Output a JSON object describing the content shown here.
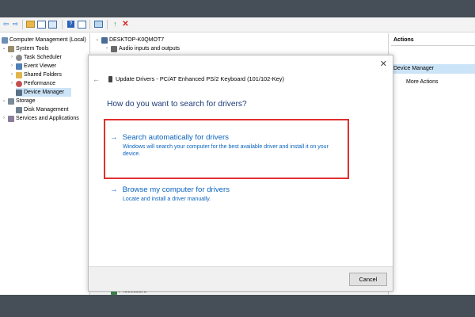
{
  "toolbar": {
    "icons": [
      "back-arrow-icon",
      "forward-arrow-icon",
      "up-folder-icon",
      "console-tree-icon",
      "properties-icon",
      "help-icon",
      "view-icon",
      "monitor-icon",
      "update-driver-icon",
      "delete-icon"
    ]
  },
  "tree": {
    "root": "Computer Management (Local)",
    "items": [
      {
        "label": "System Tools"
      },
      {
        "label": "Task Scheduler"
      },
      {
        "label": "Event Viewer"
      },
      {
        "label": "Shared Folders"
      },
      {
        "label": "Performance"
      },
      {
        "label": "Device Manager",
        "selected": true
      },
      {
        "label": "Storage"
      },
      {
        "label": "Disk Management"
      },
      {
        "label": "Services and Applications"
      }
    ]
  },
  "device_tree": {
    "computer": "DESKTOP-K0QMOT7",
    "first_node": "Audio inputs and outputs",
    "last_node": "Processors"
  },
  "actions": {
    "header": "Actions",
    "selected": "Device Manager",
    "more": "More Actions"
  },
  "dialog": {
    "title": "Update Drivers - PC/AT Enhanced PS/2 Keyboard (101/102-Key)",
    "question": "How do you want to search for drivers?",
    "option1": {
      "label": "Search automatically for drivers",
      "description": "Windows will search your computer for the best available driver and install it on your device."
    },
    "option2": {
      "label": "Browse my computer for drivers",
      "description": "Locate and install a driver manually."
    },
    "cancel": "Cancel",
    "close_glyph": "✕",
    "back_glyph": "←",
    "arrow_glyph": "→"
  },
  "colors": {
    "outer_background": "#464f57",
    "link_blue": "#0a64be",
    "heading_blue": "#1e3c78",
    "highlight_box": "#e03030",
    "selection": "#cce4f7"
  }
}
